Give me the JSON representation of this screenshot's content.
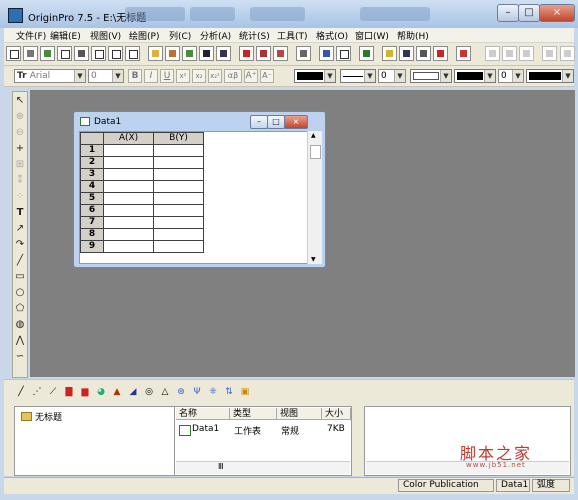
{
  "window": {
    "title": "OriginPro 7.5 - E:\\无标题",
    "min": "–",
    "max": "□",
    "close": "×"
  },
  "menu": [
    "文件(F)",
    "编辑(E)",
    "视图(V)",
    "绘图(P)",
    "列(C)",
    "分析(A)",
    "统计(S)",
    "工具(T)",
    "格式(O)",
    "窗口(W)",
    "帮助(H)"
  ],
  "format_toolbar": {
    "font": "Arial",
    "size": "0",
    "bold": "B",
    "italic": "I",
    "underline": "U",
    "superscript": "x²",
    "subscript": "x₂",
    "supsub": "x₂¹",
    "greek": "αβ",
    "grow": "A⁺",
    "shrink": "A⁻",
    "line_width": "0",
    "pattern_size": "0"
  },
  "worksheet": {
    "title": "Data1",
    "columns": [
      "A(X)",
      "B(Y)"
    ],
    "rows": [
      "1",
      "2",
      "3",
      "4",
      "5",
      "6",
      "7",
      "8",
      "9"
    ],
    "min": "–",
    "max": "□",
    "close": "×"
  },
  "explorer": {
    "tree_root": "无标题",
    "columns": [
      "名称",
      "类型",
      "视图",
      "大小"
    ],
    "items": [
      {
        "name": "Data1",
        "type": "工作表",
        "view": "常规",
        "size": "7KB"
      }
    ],
    "scroll_glyph": "Ⅲ"
  },
  "statusbar": {
    "theme": "Color Publication",
    "active": "Data1",
    "angle": "弧度"
  },
  "watermark": {
    "text": "脚本之家",
    "url": "www.jb51.net"
  },
  "colors": {
    "workspace": "#808080",
    "chrome": "#ece9d8",
    "title_bar": "#bcd2ee",
    "close_button": "#c2452e"
  }
}
